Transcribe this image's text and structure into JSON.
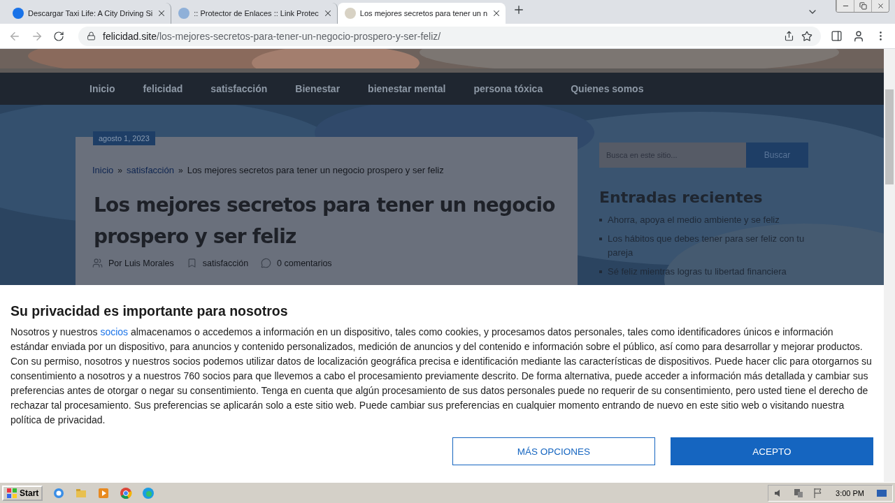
{
  "browser": {
    "tabs": [
      {
        "title": "Descargar Taxi Life: A City Driving Si",
        "selected": false
      },
      {
        "title": ":: Protector de Enlaces :: Link Protec",
        "selected": false
      },
      {
        "title": "Los mejores secretos para tener un n",
        "selected": true
      }
    ],
    "url": {
      "domain": "felicidad.site",
      "path": "/los-mejores-secretos-para-tener-un-negocio-prospero-y-ser-feliz/"
    }
  },
  "site": {
    "nav": [
      {
        "label": "Inicio"
      },
      {
        "label": "felicidad"
      },
      {
        "label": "satisfacción"
      },
      {
        "label": "Bienestar"
      },
      {
        "label": "bienestar mental"
      },
      {
        "label": "persona tóxica"
      },
      {
        "label": "Quienes somos"
      }
    ],
    "post": {
      "date": "agosto 1, 2023",
      "separator": "»",
      "breadcrumb": [
        {
          "label": "Inicio",
          "link": true
        },
        {
          "label": "satisfacción",
          "link": true
        },
        {
          "label": "Los mejores secretos para tener un negocio prospero y ser feliz",
          "link": false
        }
      ],
      "title": "Los mejores secretos para tener un negocio prospero y ser feliz",
      "author": "Por Luis Morales",
      "category": "satisfacción",
      "comments": "0 comentarios"
    },
    "sidebar": {
      "search": {
        "placeholder": "Busca en este sitio...",
        "button": "Buscar"
      },
      "recent_title": "Entradas recientes",
      "recent": [
        "Ahorra, apoya el medio ambiente y se feliz",
        "Los hábitos que debes tener para ser feliz con tu pareja",
        "Sé feliz mientras logras tu libertad financiera"
      ]
    }
  },
  "consent": {
    "title": "Su privacidad es importante para nosotros",
    "text_before": "Nosotros y nuestros",
    "link": "socios",
    "text_after": "almacenamos o accedemos a información en un dispositivo, tales como cookies, y procesamos datos personales, tales como identificadores únicos e información estándar enviada por un dispositivo, para anuncios y contenido personalizados, medición de anuncios y del contenido e información sobre el público, así como para desarrollar y mejorar productos. Con su permiso, nosotros y nuestros socios podemos utilizar datos de localización geográfica precisa e identificación mediante las características de dispositivos. Puede hacer clic para otorgarnos su consentimiento a nosotros y a nuestros 760 socios para que llevemos a cabo el procesamiento previamente descrito. De forma alternativa, puede acceder a información más detallada y cambiar sus preferencias antes de otorgar o negar su consentimiento. Tenga en cuenta que algún procesamiento de sus datos personales puede no requerir de su consentimiento, pero usted tiene el derecho de rechazar tal procesamiento. Sus preferencias se aplicarán solo a este sitio web. Puede cambiar sus preferencias en cualquier momento entrando de nuevo en este sitio web o visitando nuestra política de privacidad.",
    "buttons": [
      {
        "label": "MÁS OPCIONES",
        "kind": "secondary"
      },
      {
        "label": "ACEPTO",
        "kind": "primary"
      }
    ]
  },
  "taskbar": {
    "start": "Start",
    "clock": "3:00 PM"
  }
}
